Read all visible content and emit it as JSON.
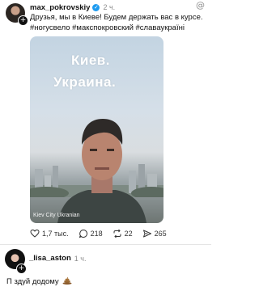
{
  "post": {
    "username": "max_pokrovskiy",
    "timestamp": "2 ч.",
    "text": "Друзья, мы в Киеве! Будем держать вас в курсе.\n#ногусвело #макспокровский #славаукраїні",
    "video": {
      "overlay_line1": "Киев.",
      "overlay_line2": "Украина.",
      "caption": "Kiev City Ukranian"
    },
    "actions": {
      "likes": "1,7 тыс.",
      "comments": "218",
      "reposts": "22",
      "shares": "265"
    },
    "icons": [
      "plus-badge-icon",
      "verified-badge-icon",
      "threads-logo-icon",
      "heart-icon",
      "comment-icon",
      "repost-icon",
      "share-icon"
    ],
    "colors": {
      "verified": "#1d9bf0",
      "meta": "#8e8e8e"
    }
  },
  "reply": {
    "username": "_lisa_aston",
    "timestamp": "1 ч.",
    "text": "П здуй додому",
    "emoji": "poop-emoji"
  }
}
